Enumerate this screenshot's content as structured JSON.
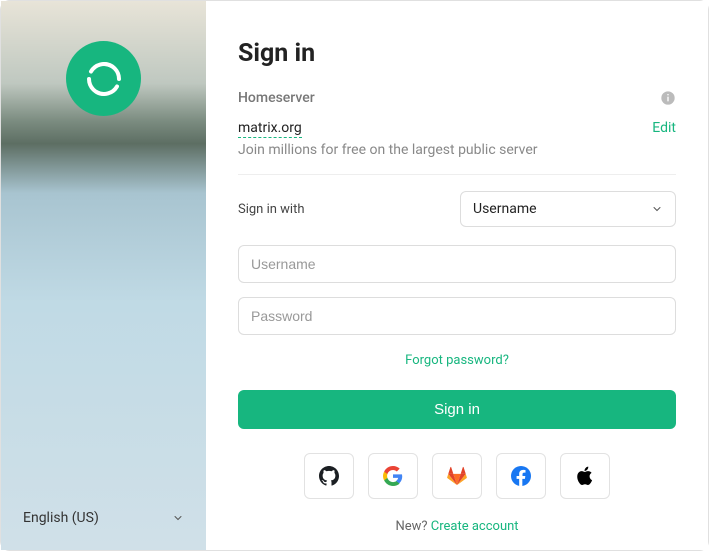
{
  "language": {
    "selected": "English (US)"
  },
  "signin": {
    "title": "Sign in",
    "homeserver_label": "Homeserver",
    "homeserver_value": "matrix.org",
    "homeserver_edit": "Edit",
    "homeserver_desc": "Join millions for free on the largest public server",
    "signinwith_label": "Sign in with",
    "method_selected": "Username",
    "username_placeholder": "Username",
    "password_placeholder": "Password",
    "forgot": "Forgot password?",
    "submit": "Sign in",
    "oauth": {
      "github": "github-icon",
      "google": "google-icon",
      "gitlab": "gitlab-icon",
      "facebook": "facebook-icon",
      "apple": "apple-icon"
    },
    "new_prompt": "New? ",
    "create_account": "Create account"
  }
}
